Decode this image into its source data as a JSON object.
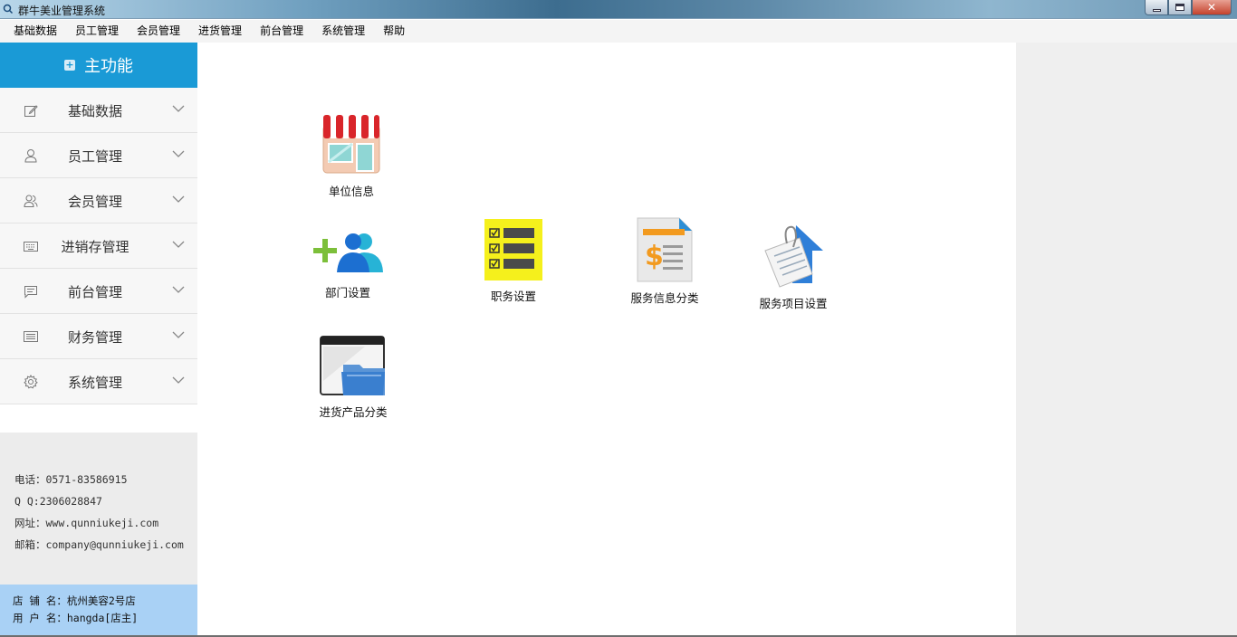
{
  "window": {
    "title": "群牛美业管理系统",
    "close_glyph": "✕"
  },
  "menubar": {
    "items": [
      {
        "label": "基础数据"
      },
      {
        "label": "员工管理"
      },
      {
        "label": "会员管理"
      },
      {
        "label": "进货管理"
      },
      {
        "label": "前台管理"
      },
      {
        "label": "系统管理"
      },
      {
        "label": "帮助"
      }
    ]
  },
  "sidebar": {
    "header": "主功能",
    "items": [
      {
        "label": "基础数据",
        "icon": "edit-icon"
      },
      {
        "label": "员工管理",
        "icon": "user-icon"
      },
      {
        "label": "会员管理",
        "icon": "users-icon"
      },
      {
        "label": "进销存管理",
        "icon": "keyboard-icon"
      },
      {
        "label": "前台管理",
        "icon": "message-icon"
      },
      {
        "label": "财务管理",
        "icon": "list-icon"
      },
      {
        "label": "系统管理",
        "icon": "gear-icon"
      }
    ],
    "contact": {
      "phone": "电话：0571-83586915",
      "qq": "Q  Q:2306028847",
      "website": "网址：www.qunniukeji.com",
      "email": "邮箱：company@qunniukeji.com"
    },
    "store": {
      "name": "店 铺 名：杭州美容2号店",
      "user": "用 户 名：hangda[店主]"
    }
  },
  "tiles": [
    {
      "label": "单位信息",
      "icon": "storefront-icon"
    },
    {
      "label": "部门设置",
      "icon": "add-group-icon"
    },
    {
      "label": "职务设置",
      "icon": "checklist-icon"
    },
    {
      "label": "服务信息分类",
      "icon": "invoice-dollar-icon"
    },
    {
      "label": "服务项目设置",
      "icon": "document-upload-icon"
    },
    {
      "label": "进货产品分类",
      "icon": "folder-window-icon"
    }
  ],
  "colors": {
    "sidebar_header": "#1a9ad6",
    "store_block": "#a9d1f5",
    "right_pane": "#efefef"
  }
}
